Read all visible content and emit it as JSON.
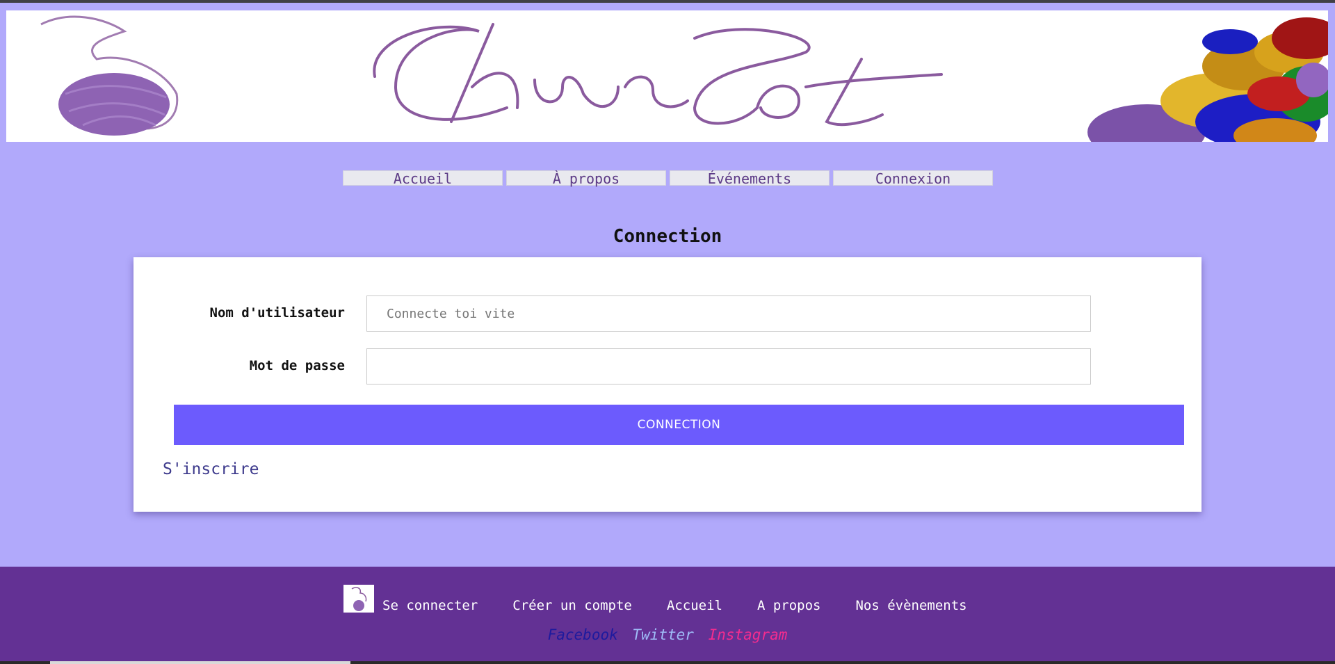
{
  "banner": {
    "logo_text": "ChreeCot",
    "logo_color": "#8a5a9e"
  },
  "nav": {
    "items": [
      {
        "label": "Accueil"
      },
      {
        "label": "À propos"
      },
      {
        "label": "Événements"
      },
      {
        "label": "Connexion"
      }
    ]
  },
  "login": {
    "title": "Connection",
    "username_label": "Nom d'utilisateur",
    "username_placeholder": "Connecte toi vite",
    "password_label": "Mot de passe",
    "password_value": "",
    "submit_label": "CONNECTION",
    "register_link": "S'inscrire"
  },
  "footer": {
    "links": [
      {
        "label": "Se connecter"
      },
      {
        "label": "Créer un compte"
      },
      {
        "label": "Accueil"
      },
      {
        "label": "A propos"
      },
      {
        "label": "Nos évènements"
      }
    ],
    "social": {
      "facebook": "Facebook",
      "twitter": "Twitter",
      "instagram": "Instagram"
    }
  },
  "colors": {
    "page_bg": "#b1a9fb",
    "footer_bg": "#633194",
    "button_bg": "#6c5bfd",
    "facebook": "#1d1a9e",
    "twitter": "#9fbcf7",
    "instagram": "#f42c8f"
  }
}
